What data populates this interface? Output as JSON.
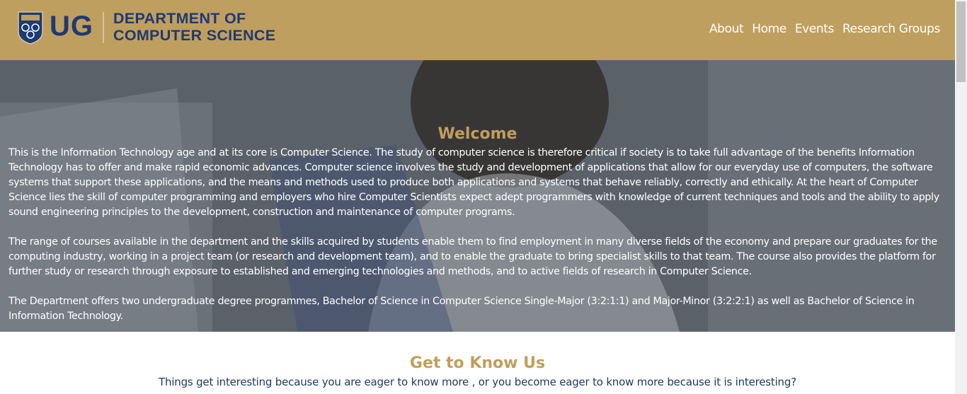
{
  "header": {
    "logo_short": "UG",
    "logo_line1": "DEPARTMENT OF",
    "logo_line2": "COMPUTER SCIENCE",
    "nav": [
      "About",
      "Home",
      "Events",
      "Research Groups"
    ]
  },
  "hero": {
    "title": "Welcome",
    "paragraphs": [
      "This is the Information Technology age and at its core is Computer Science. The study of computer science is therefore critical if society is to take full advantage of the benefits Information Technology has to offer and make rapid economic advances. Computer science involves the study and development of applications that allow for our everyday use of computers, the software systems that support these applications, and the means and methods used to produce both applications and systems that behave reliably, correctly and ethically. At the heart of Computer Science lies the skill of computer programming and employers who hire Computer Scientists expect adept programmers with knowledge of current techniques and tools and the ability to apply sound engineering principles to the development, construction and maintenance of computer programs.",
      "The range of courses available in the department and the skills acquired by students enable them to find employment in many diverse fields of the economy and prepare our graduates for the computing industry, working in a project team (or research and development team), and to enable the graduate to bring specialist skills to that team. The course also provides the platform for further study or research through exposure to established and emerging technologies and methods, and to active fields of research in Computer Science.",
      "The Department offers two undergraduate degree programmes, Bachelor of Science in Computer Science Single-Major (3:2:1:1) and Major-Minor (3:2:2:1) as well as Bachelor of Science in Information Technology."
    ]
  },
  "section": {
    "title": "Get to Know Us",
    "tagline": "Things get interesting because you are eager to know more , or you become eager to know more because it is interesting?"
  },
  "colors": {
    "header_bg": "#bf9f5f",
    "brand_blue": "#1e3a72",
    "gold": "#bf9f5f"
  },
  "icons": {
    "crest": "ug-crest-icon"
  }
}
